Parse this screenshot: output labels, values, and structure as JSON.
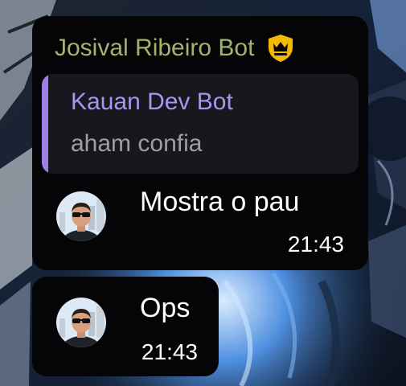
{
  "chat": {
    "messages": [
      {
        "sender": "Josival Ribeiro Bot",
        "sender_badge": "crown-icon",
        "reply": {
          "author": "Kauan Dev Bot",
          "text": "aham confia"
        },
        "text": "Mostra o pau",
        "time": "21:43"
      },
      {
        "text": "Ops",
        "time": "21:43"
      }
    ]
  },
  "colors": {
    "bubble_background": "#050507",
    "sender_name": "#a2b46b",
    "badge": "#f5b800",
    "reply_bar": "#9b82e6",
    "reply_author": "#a895f0",
    "reply_text": "#9e9ea4",
    "message_text": "#ffffff"
  }
}
